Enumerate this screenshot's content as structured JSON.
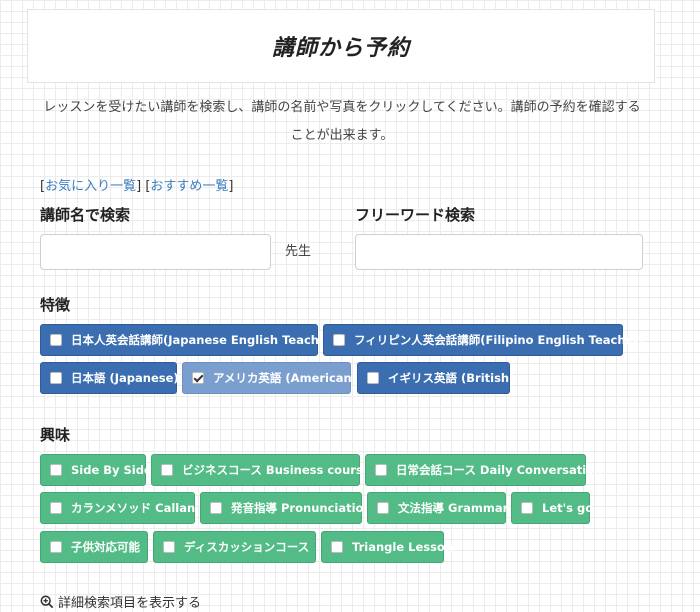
{
  "header": {
    "title": "講師から予約"
  },
  "intro": {
    "text": "レッスンを受けたい講師を検索し、講師の名前や写真をクリックしてください。講師の予約を確認することが出来ます。"
  },
  "links": {
    "bracket_open": "[",
    "bracket_close": "]",
    "favorites": "お気に入り一覧",
    "recommended": "おすすめ一覧"
  },
  "search": {
    "name_label": "講師名で検索",
    "name_value": "",
    "name_suffix": "先生",
    "freeword_label": "フリーワード検索",
    "freeword_value": ""
  },
  "features": {
    "label": "特徴",
    "items": [
      {
        "label": "日本人英会話講師(Japanese English Teacher)",
        "checked": false
      },
      {
        "label": "フィリピン人英会話講師(Filipino English Teacher)",
        "checked": false
      },
      {
        "label": "日本語 (Japanese)",
        "checked": false
      },
      {
        "label": "アメリカ英語 (American)",
        "checked": true
      },
      {
        "label": "イギリス英語 (British)",
        "checked": false
      }
    ]
  },
  "interests": {
    "label": "興味",
    "items": [
      {
        "label": "Side By Side",
        "checked": false
      },
      {
        "label": "ビジネスコース Business course",
        "checked": false
      },
      {
        "label": "日常会話コース Daily Conversation",
        "checked": false
      },
      {
        "label": "カランメソッド Callan",
        "checked": false
      },
      {
        "label": "発音指導 Pronunciation",
        "checked": false
      },
      {
        "label": "文法指導 Grammar",
        "checked": false
      },
      {
        "label": "Let's go",
        "checked": false
      },
      {
        "label": "子供対応可能",
        "checked": false
      },
      {
        "label": "ディスカッションコース",
        "checked": false
      },
      {
        "label": "Triangle Lesson",
        "checked": false
      }
    ]
  },
  "advanced": {
    "label": "詳細検索項目を表示する",
    "icon": "zoom-in-icon"
  },
  "colors": {
    "feature_chip": "#3a6eb0",
    "interest_chip": "#52bb86",
    "link": "#3a7cc0"
  }
}
